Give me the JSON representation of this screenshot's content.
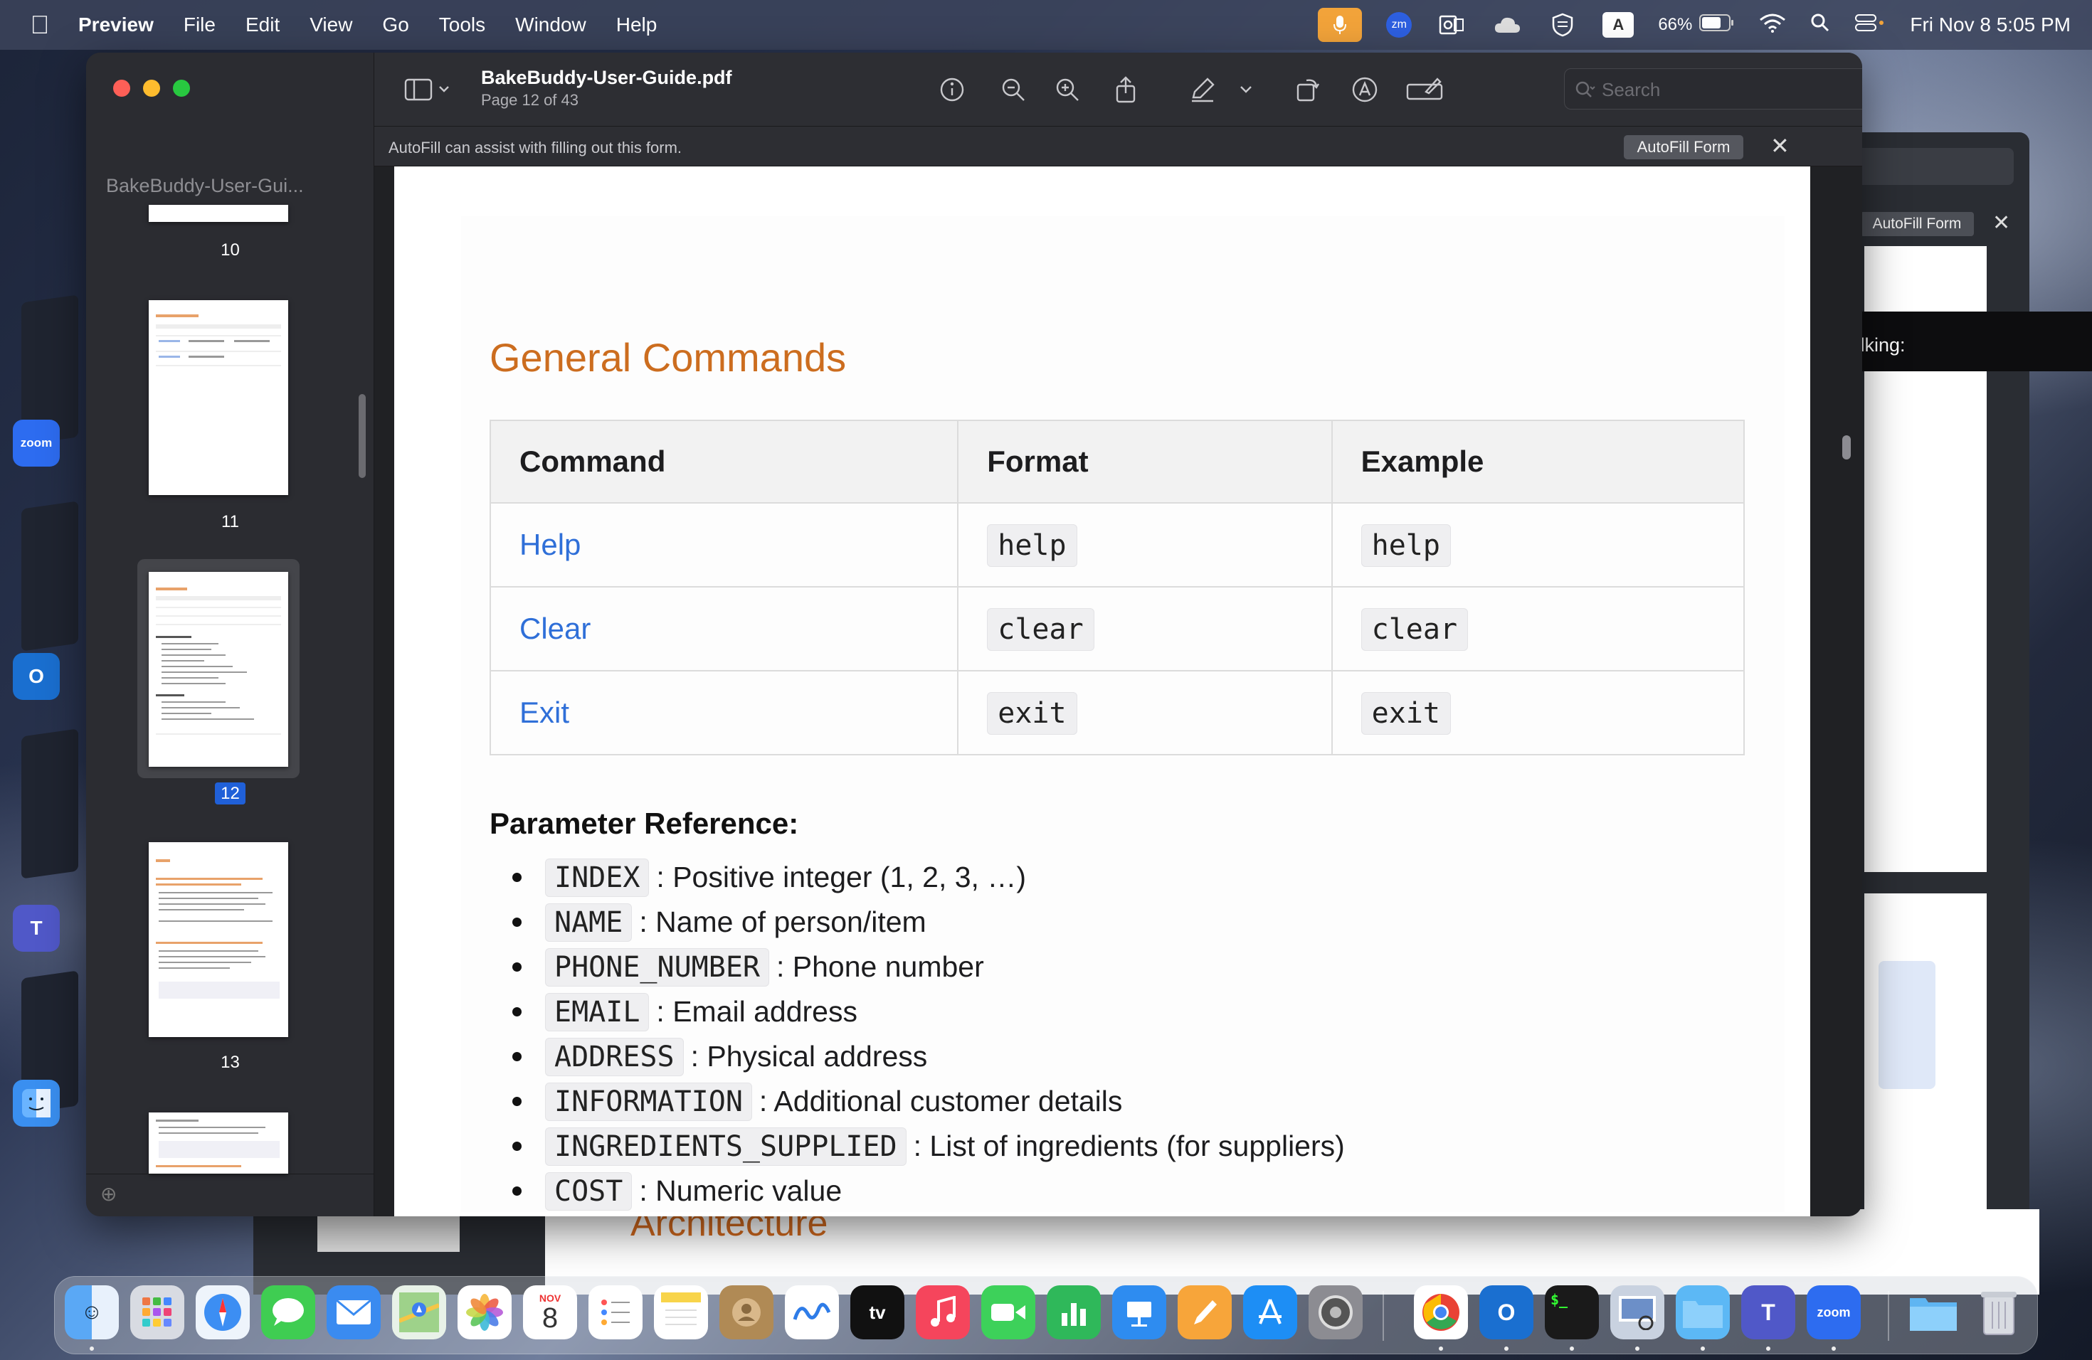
{
  "menubar": {
    "app": "Preview",
    "items": [
      "File",
      "Edit",
      "View",
      "Go",
      "Tools",
      "Window",
      "Help"
    ],
    "battery": "66%",
    "datetime": "Fri Nov 8  5:05 PM",
    "zoom_badge": "zm",
    "input_source": "A"
  },
  "talking": "Talking:",
  "window": {
    "title": "BakeBuddy-User-Guide.pdf",
    "subtitle": "Page 12 of 43",
    "search_placeholder": "Search",
    "autofill_message": "AutoFill can assist with filling out this form.",
    "autofill_button": "AutoFill Form"
  },
  "sidebar": {
    "doc_title": "BakeBuddy-User-Gui...",
    "pages": [
      "10",
      "11",
      "12",
      "13"
    ],
    "selected_page": "12"
  },
  "doc": {
    "heading": "General Commands",
    "table": {
      "headers": [
        "Command",
        "Format",
        "Example"
      ],
      "rows": [
        {
          "command": "Help",
          "format": "help",
          "example": "help"
        },
        {
          "command": "Clear",
          "format": "clear",
          "example": "clear"
        },
        {
          "command": "Exit",
          "format": "exit",
          "example": "exit"
        }
      ]
    },
    "param_heading": "Parameter Reference:",
    "params": [
      {
        "code": "INDEX",
        "desc": ": Positive integer (1, 2, 3, …)"
      },
      {
        "code": "NAME",
        "desc": ": Name of person/item"
      },
      {
        "code": "PHONE_NUMBER",
        "desc": ": Phone number"
      },
      {
        "code": "EMAIL",
        "desc": ": Email address"
      },
      {
        "code": "ADDRESS",
        "desc": ": Physical address"
      },
      {
        "code": "INFORMATION",
        "desc": ": Additional customer details"
      },
      {
        "code": "INGREDIENTS_SUPPLIED",
        "desc": ": List of ingredients (for suppliers)"
      },
      {
        "code": "COST",
        "desc": ": Numeric value"
      }
    ]
  },
  "background": {
    "behind_heading": "Architecture",
    "behind_autofill": "AutoFill Form"
  },
  "dock": {
    "calendar_month": "NOV",
    "calendar_day": "8",
    "tv_label": "tv",
    "zoom_label": "zoom",
    "terminal_label": "$_",
    "outlook_label": "O",
    "teams_label": "T"
  },
  "left_apps": {
    "zoom_label": "zoom",
    "outlook_label": "O",
    "teams_label": "T"
  },
  "colors": {
    "heading_orange": "#cc6d1f",
    "link_blue": "#2f6fd8",
    "selection_blue": "#2060d8",
    "mic_orange": "#f2a33a"
  }
}
